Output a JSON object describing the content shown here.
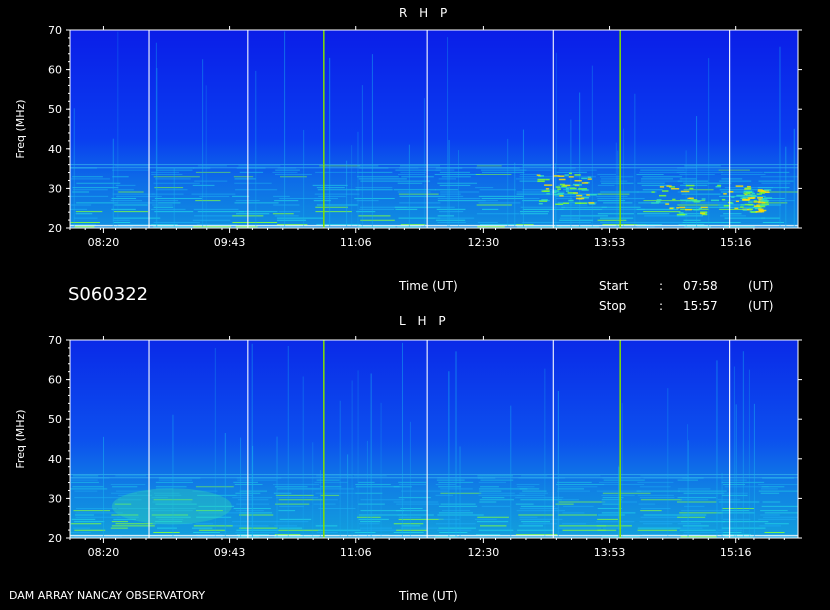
{
  "date_label": "S060322",
  "footer_label": "DAM ARRAY   NANCAY OBSERVATORY",
  "time_axis_label": "Time (UT)",
  "start": {
    "label": "Start",
    "sep": ":",
    "value": "07:58",
    "unit": "(UT)"
  },
  "stop": {
    "label": "Stop",
    "sep": ":",
    "value": "15:57",
    "unit": "(UT)"
  },
  "colors": {
    "background": "#0000ff",
    "frame": "#ffffff",
    "marker_line": "#ffffff",
    "green_line": "#7fe000"
  },
  "chart_data": [
    {
      "type": "heatmap",
      "title": "R H P",
      "xlabel": "Time (UT)",
      "ylabel": "Freq (MHz)",
      "xlim": [
        "07:58",
        "15:57"
      ],
      "ylim": [
        20,
        70
      ],
      "x_ticks": [
        "08:20",
        "09:43",
        "11:06",
        "12:30",
        "13:53",
        "15:16"
      ],
      "y_ticks": [
        20,
        30,
        40,
        50,
        60,
        70
      ]
    },
    {
      "type": "heatmap",
      "title": "L H P",
      "xlabel": "Time (UT)",
      "ylabel": "Freq (MHz)",
      "xlim": [
        "07:58",
        "15:57"
      ],
      "ylim": [
        20,
        70
      ],
      "x_ticks": [
        "08:20",
        "09:43",
        "11:06",
        "12:30",
        "13:53",
        "15:16"
      ],
      "y_ticks": [
        20,
        30,
        40,
        50,
        60,
        70
      ]
    }
  ]
}
